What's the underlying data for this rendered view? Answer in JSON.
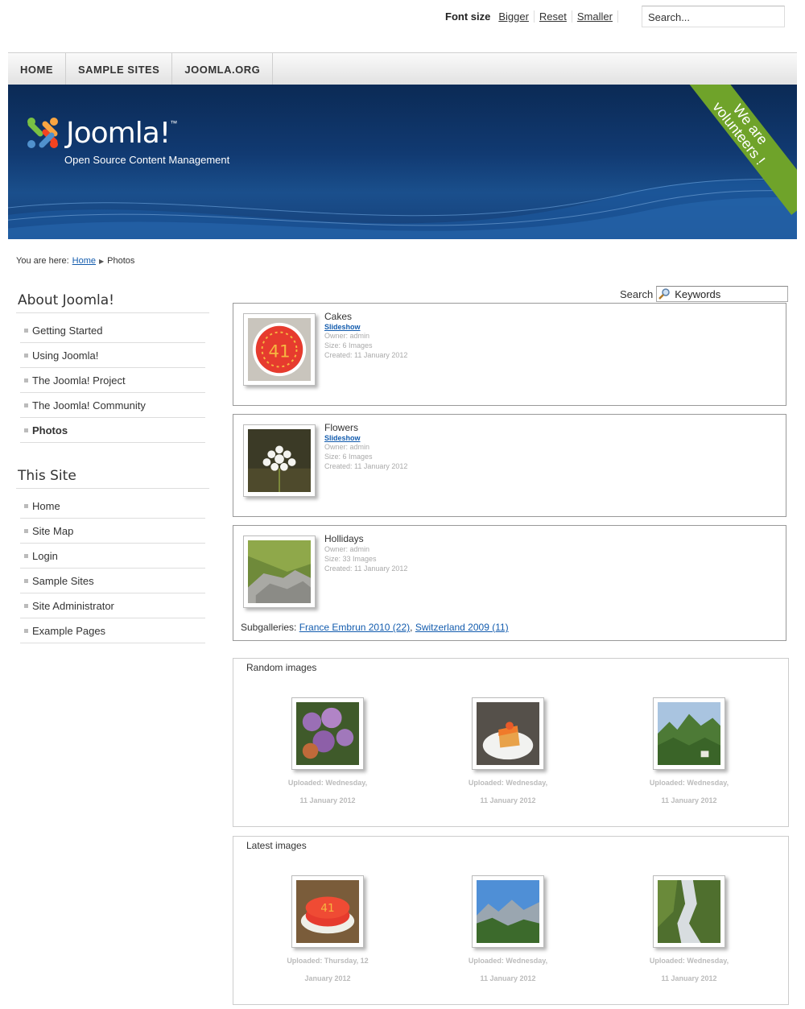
{
  "topbar": {
    "font_size_label": "Font size",
    "bigger": "Bigger",
    "reset": "Reset",
    "smaller": "Smaller",
    "search_placeholder": "Search..."
  },
  "nav": {
    "items": [
      "HOME",
      "SAMPLE SITES",
      "JOOMLA.ORG"
    ]
  },
  "header": {
    "logo_text": "Joomla!",
    "logo_tm": "™",
    "tagline": "Open Source Content Management",
    "ribbon_line1": "We are",
    "ribbon_line2": "volunteers !"
  },
  "breadcrumb": {
    "prefix": "You are here:",
    "home": "Home",
    "current": "Photos"
  },
  "sidebar": {
    "about_title": "About Joomla!",
    "about_items": [
      "Getting Started",
      "Using Joomla!",
      "The Joomla! Project",
      "The Joomla! Community",
      "Photos"
    ],
    "site_title": "This Site",
    "site_items": [
      "Home",
      "Site Map",
      "Login",
      "Sample Sites",
      "Site Administrator",
      "Example Pages"
    ]
  },
  "main": {
    "search_label": "Search",
    "search_placeholder": "Keywords",
    "galleries": [
      {
        "title": "Cakes",
        "slideshow": "Slideshow",
        "owner": "Owner: admin",
        "size": "Size: 6 Images",
        "created": "Created: 11 January 2012"
      },
      {
        "title": "Flowers",
        "slideshow": "Slideshow",
        "owner": "Owner: admin",
        "size": "Size: 6 Images",
        "created": "Created: 11 January 2012"
      },
      {
        "title": "Hollidays",
        "owner": "Owner: admin",
        "size": "Size: 33 Images",
        "created": "Created: 11 January 2012",
        "subgalleries_label": "Subgalleries:",
        "sub1": "France Embrun 2010 (22)",
        "sub_sep": ",",
        "sub2": "Switzerland 2009 (11)"
      }
    ],
    "random": {
      "title": "Random images",
      "items": [
        {
          "line1": "Uploaded: Wednesday,",
          "line2": "11 January 2012"
        },
        {
          "line1": "Uploaded: Wednesday,",
          "line2": "11 January 2012"
        },
        {
          "line1": "Uploaded: Wednesday,",
          "line2": "11 January 2012"
        }
      ]
    },
    "latest": {
      "title": "Latest images",
      "items": [
        {
          "line1": "Uploaded: Thursday, 12",
          "line2": "January 2012"
        },
        {
          "line1": "Uploaded: Wednesday,",
          "line2": "11 January 2012"
        },
        {
          "line1": "Uploaded: Wednesday,",
          "line2": "11 January 2012"
        }
      ]
    }
  }
}
